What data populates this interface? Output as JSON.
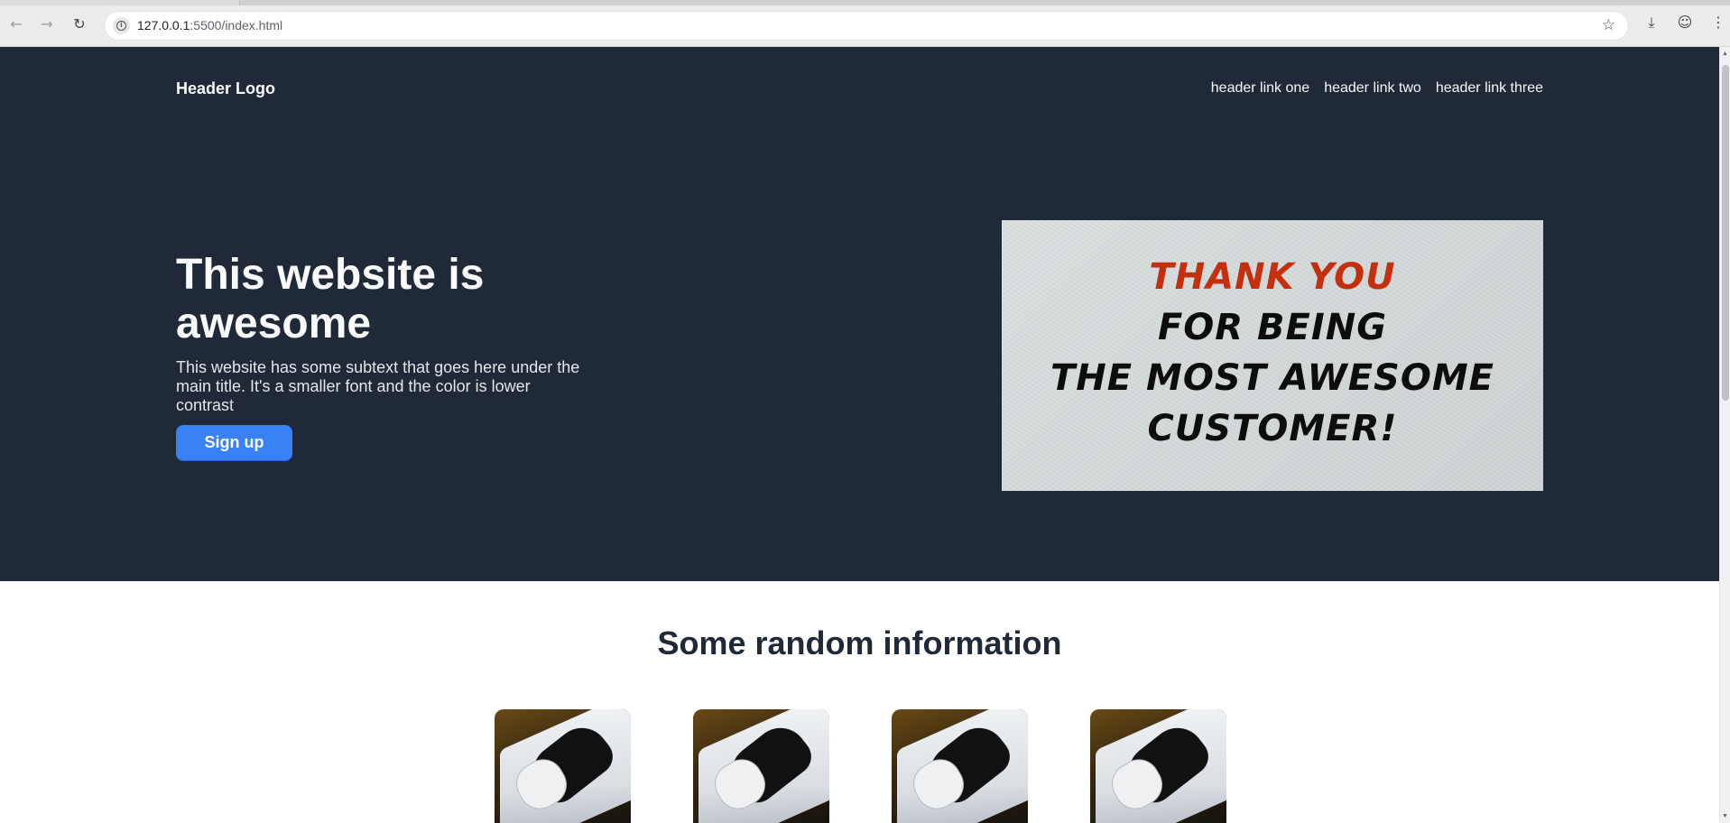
{
  "browser": {
    "url_host": "127.0.0.1",
    "url_path": ":5500/index.html",
    "icons": [
      "back-icon",
      "forward-icon",
      "reload-icon",
      "info-icon",
      "star-icon",
      "download-icon",
      "profile-icon",
      "menu-icon"
    ]
  },
  "header": {
    "logo": "Header Logo",
    "links": [
      "header link one",
      "header link two",
      "header link three"
    ]
  },
  "hero": {
    "title": "This website is awesome",
    "subtext": "This website has some subtext that goes here under the main title. It's a smaller font and the color is lower contrast",
    "cta_label": "Sign up",
    "image_text": [
      "THANK YOU",
      "FOR BEING",
      "THE MOST AWESOME",
      "CUSTOMER!"
    ]
  },
  "info_section": {
    "title": "Some random information"
  },
  "colors": {
    "hero_bg": "#1f2937",
    "cta_bg": "#3882f6",
    "card_accent": "#c42f0e"
  }
}
